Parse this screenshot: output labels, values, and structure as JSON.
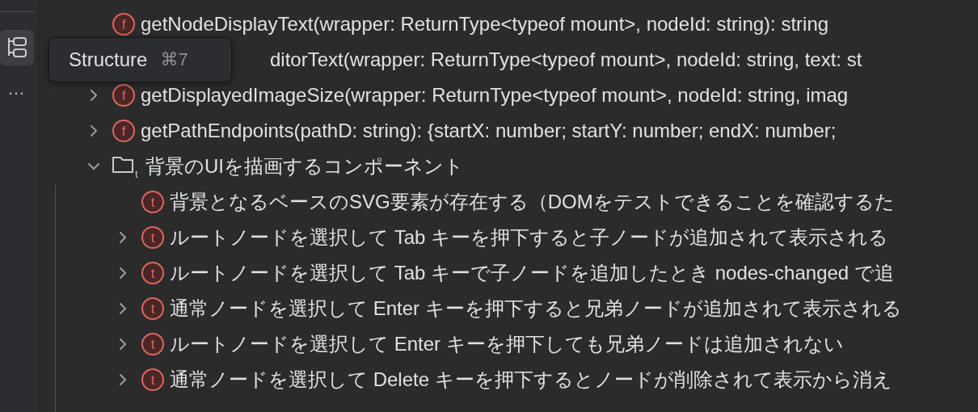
{
  "tooltip": {
    "title": "Structure",
    "shortcut": "⌘7"
  },
  "sidebar": {
    "more": "…",
    "structure_selected": true
  },
  "tree": [
    {
      "kind": "function",
      "icon_letter": "f",
      "text": "getNodeDisplayText(wrapper: ReturnType<typeof mount>, nodeId: string): string"
    },
    {
      "kind": "covered",
      "text": "ditorText(wrapper: ReturnType<typeof mount>, nodeId: string, text: st"
    },
    {
      "kind": "function",
      "icon_letter": "f",
      "expanded": false,
      "text": "getDisplayedImageSize(wrapper: ReturnType<typeof mount>, nodeId: string, imag"
    },
    {
      "kind": "function",
      "icon_letter": "f",
      "expanded": false,
      "text": "getPathEndpoints(pathD: string): {startX: number; startY: number; endX: number;"
    },
    {
      "kind": "suite",
      "icon_letter": "t",
      "expanded": true,
      "text": "背景のUIを描画するコンポーネント",
      "children": [
        {
          "kind": "test",
          "icon_letter": "t",
          "text": "背景となるベースのSVG要素が存在する（DOMをテストできることを確認するた"
        },
        {
          "kind": "test",
          "icon_letter": "t",
          "expanded": false,
          "text": "ルートノードを選択して Tab キーを押下すると子ノードが追加されて表示される"
        },
        {
          "kind": "test",
          "icon_letter": "t",
          "expanded": false,
          "text": "ルートノードを選択して Tab キーで子ノードを追加したとき nodes-changed で追"
        },
        {
          "kind": "test",
          "icon_letter": "t",
          "expanded": false,
          "text": "通常ノードを選択して Enter キーを押下すると兄弟ノードが追加されて表示される"
        },
        {
          "kind": "test",
          "icon_letter": "t",
          "expanded": false,
          "text": "ルートノードを選択して Enter キーを押下しても兄弟ノードは追加されない"
        },
        {
          "kind": "test",
          "icon_letter": "t",
          "expanded": false,
          "text": "通常ノードを選択して Delete キーを押下するとノードが削除されて表示から消え"
        }
      ]
    }
  ]
}
